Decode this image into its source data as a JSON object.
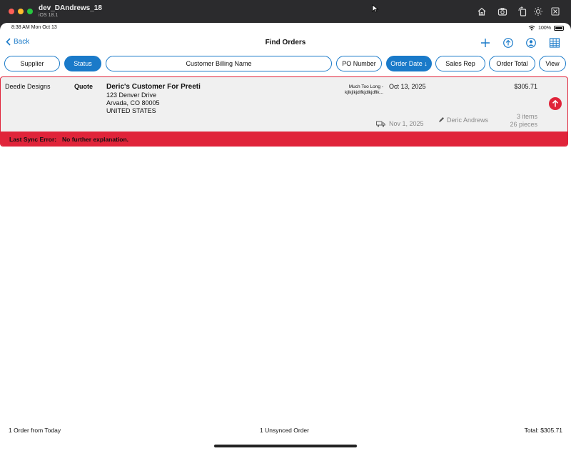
{
  "simulator": {
    "device_name": "dev_DAndrews_18",
    "os_version": "iOS 18.1"
  },
  "status_bar": {
    "time_date": "8:38 AM  Mon Oct 13",
    "battery": "100%"
  },
  "nav": {
    "back_label": "Back",
    "title": "Find Orders"
  },
  "filters": [
    {
      "label": "Supplier",
      "active": false
    },
    {
      "label": "Status",
      "active": true
    },
    {
      "label": "Customer Billing Name",
      "active": false
    },
    {
      "label": "PO Number",
      "active": false
    },
    {
      "label": "Order Date ↓",
      "active": true
    },
    {
      "label": "Sales Rep",
      "active": false
    },
    {
      "label": "Order Total",
      "active": false
    },
    {
      "label": "View",
      "active": false
    }
  ],
  "order": {
    "supplier": "Deedle Designs",
    "status": "Quote",
    "customer_name": "Deric's Customer For Preeti",
    "address_line1": "123 Denver Drive",
    "address_line2": "Arvada, CO  80005",
    "address_line3": "UNITED STATES",
    "po_line1": "Much Too Long -",
    "po_line2": "kjlkjlkjdlfkjdlkjdflk...",
    "order_date": "Oct 13, 2025",
    "total": "$305.71",
    "ship_date": "Nov 1, 2025",
    "sales_rep": "Deric Andrews",
    "items": "3 items",
    "pieces": "26 pieces"
  },
  "sync_error": {
    "label": "Last Sync Error:",
    "message": "No further explanation."
  },
  "footer": {
    "left": "1 Order from Today",
    "center": "1 Unsynced Order",
    "right": "Total: $305.71"
  },
  "colors": {
    "accent": "#1a7ac9",
    "error": "#e0243a",
    "row_bg": "#f0f0f0"
  }
}
